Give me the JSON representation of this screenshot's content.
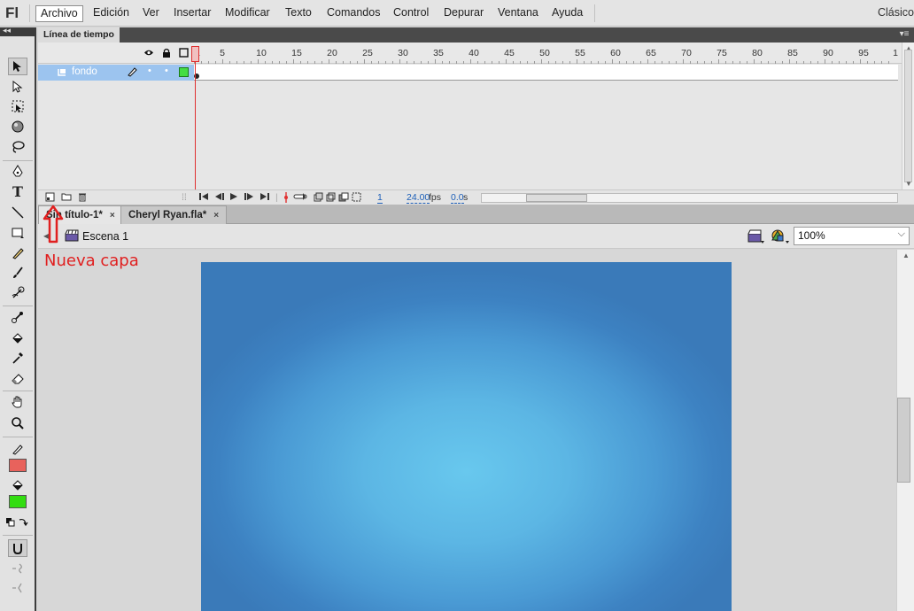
{
  "app": {
    "logo": "Fl",
    "workspace": "Clásico"
  },
  "menu": [
    "Archivo",
    "Edición",
    "Ver",
    "Insertar",
    "Modificar",
    "Texto",
    "Comandos",
    "Control",
    "Depurar",
    "Ventana",
    "Ayuda"
  ],
  "timeline": {
    "tab_label": "Línea de tiempo",
    "frame_numbers": [
      "1",
      "5",
      "10",
      "15",
      "20",
      "25",
      "30",
      "35",
      "40",
      "45",
      "50",
      "55",
      "60",
      "65",
      "70",
      "75",
      "80",
      "85",
      "90",
      "95",
      "1"
    ],
    "layer_name": "fondo",
    "current_frame": "1",
    "fps": "24.00",
    "fps_unit": "fps",
    "time": "0.0",
    "time_unit": "s"
  },
  "doc_tabs": [
    {
      "label": "Sin título-1*",
      "close": "×",
      "active": true
    },
    {
      "label": "Cheryl Ryan.fla*",
      "close": "×",
      "active": false
    }
  ],
  "edit_bar": {
    "scene_label": "Escena 1",
    "zoom": "100%"
  },
  "annotation": {
    "label": "Nueva capa",
    "color": "#e02020"
  },
  "colors": {
    "stroke": "#e8625c",
    "fill": "#33dd11",
    "stage_center": "#68c8ee",
    "stage_edge": "#3a7ab9"
  }
}
